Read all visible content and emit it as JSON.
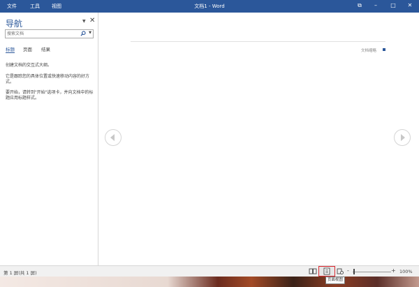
{
  "titlebar": {
    "menu": [
      "文件",
      "工具",
      "视图"
    ],
    "title": "文档1 - Word",
    "controls": {
      "restore": "⧉",
      "minimize": "–",
      "maximize": "□",
      "close": "✕"
    },
    "color": "#2b579a"
  },
  "nav": {
    "title": "导航",
    "dropdown": "▼",
    "close": "✕",
    "search_placeholder": "搜索文档",
    "tabs": [
      "标题",
      "页面",
      "结果"
    ],
    "text1": "创建文档的交互式大纲。",
    "text2": "它是跟踪您的具体位置或快速移动内容的好方式。",
    "text3": "要开始，请转到\"开始\"选项卡，并向文档中的标题应用标题样式。"
  },
  "doc": {
    "zoom_label": "文档缩略",
    "prev_icon": "left-arrow-icon",
    "next_icon": "right-arrow-icon"
  },
  "status": {
    "page_info": "第 1 屏(共 1 屏)",
    "zoom_minus": "-",
    "zoom_plus": "+",
    "zoom_percent": "100%",
    "tooltip": "页面视图"
  }
}
